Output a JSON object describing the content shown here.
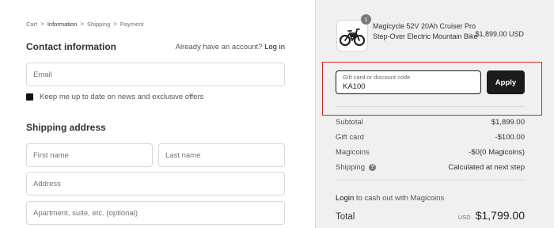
{
  "breadcrumb": {
    "items": [
      "Cart",
      "Information",
      "Shipping",
      "Payment"
    ],
    "current_index": 1,
    "separator": ">"
  },
  "contact": {
    "title": "Contact information",
    "account_prompt": "Already have an account?",
    "login_label": "Log in",
    "email_placeholder": "Email",
    "newsletter_label": "Keep me up to date on news and exclusive offers",
    "newsletter_checked": true
  },
  "shipping": {
    "title": "Shipping address",
    "first_name_placeholder": "First name",
    "last_name_placeholder": "Last name",
    "address_placeholder": "Address",
    "apartment_placeholder": "Apartment, suite, etc. (optional)"
  },
  "order": {
    "product": {
      "name": "Magicycle 52V 20Ah Cruiser Pro Step-Over Electric Mountain Bike",
      "quantity": "1",
      "price": "$1,899.00 USD",
      "image_icon": "ebike-icon"
    },
    "discount": {
      "label": "Gift card or discount code",
      "value": "KA100",
      "apply_label": "Apply"
    },
    "summary": [
      {
        "label": "Subtotal",
        "value": "$1,899.00"
      },
      {
        "label": "Gift card",
        "value": "-$100.00"
      },
      {
        "label": "Magicoins",
        "value": "-$0(0 Magicoins)"
      },
      {
        "label": "Shipping",
        "value": "Calculated at next step",
        "help_icon": "question-icon"
      }
    ],
    "cash_out_link": "Login",
    "cash_out_text": " to cash out with Magicoins",
    "total_label": "Total",
    "total_currency": "USD",
    "total_amount": "$1,799.00"
  },
  "colors": {
    "highlight": "#e0201a",
    "button_bg": "#1b1b1b",
    "sidebar_bg": "#f0f0f1"
  }
}
